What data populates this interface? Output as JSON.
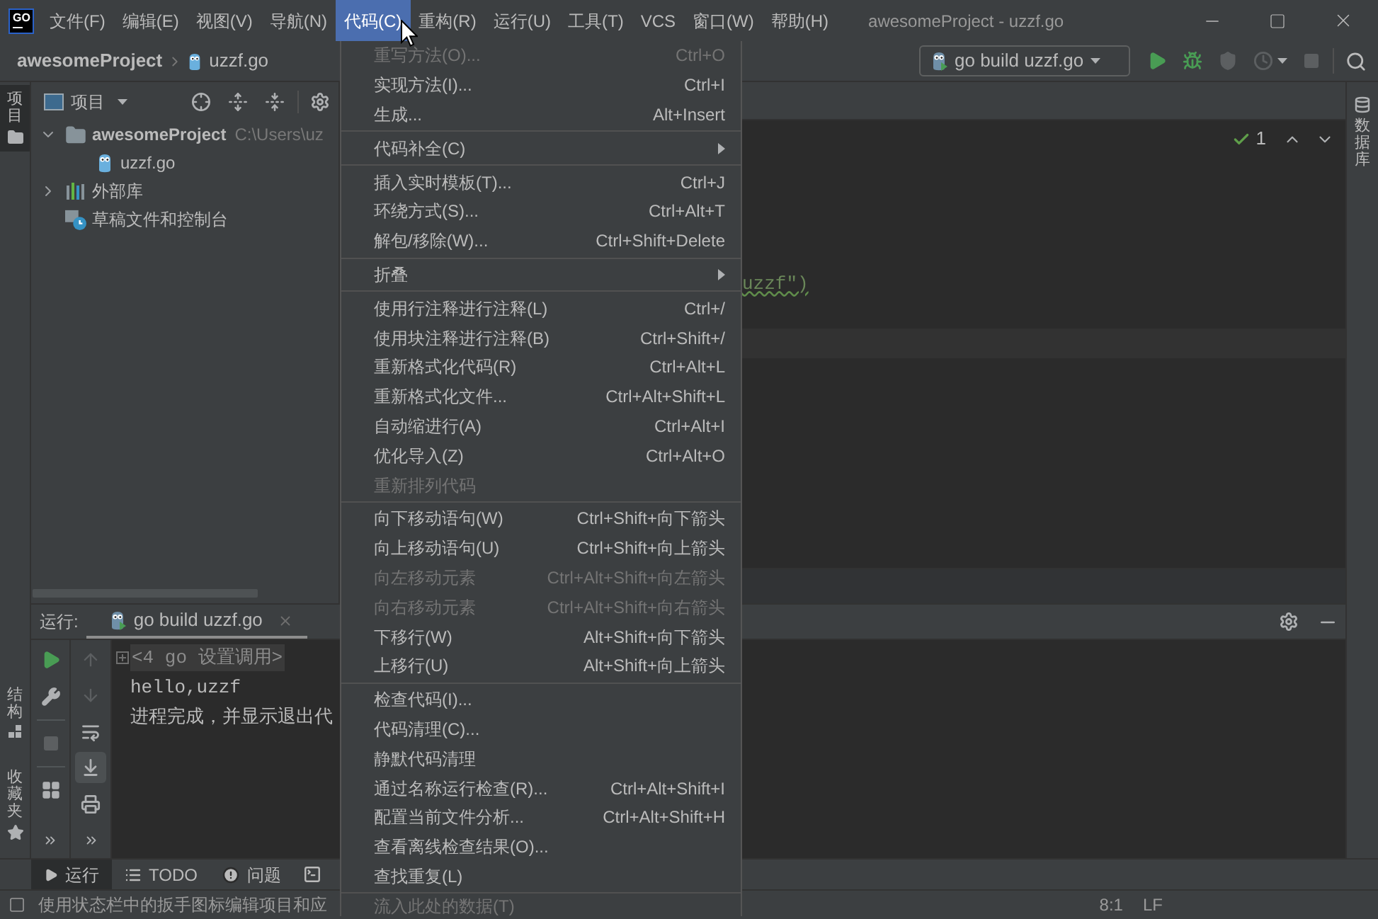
{
  "menubar": {
    "logo": "GO",
    "items": [
      {
        "label": "文件(F)",
        "selected": false
      },
      {
        "label": "编辑(E)",
        "selected": false
      },
      {
        "label": "视图(V)",
        "selected": false
      },
      {
        "label": "导航(N)",
        "selected": false
      },
      {
        "label": "代码(C)",
        "selected": true
      },
      {
        "label": "重构(R)",
        "selected": false
      },
      {
        "label": "运行(U)",
        "selected": false
      },
      {
        "label": "工具(T)",
        "selected": false
      },
      {
        "label": "VCS",
        "selected": false
      },
      {
        "label": "窗口(W)",
        "selected": false
      },
      {
        "label": "帮助(H)",
        "selected": false
      }
    ],
    "title": "awesomeProject - uzzf.go"
  },
  "navbar": {
    "breadcrumbs": [
      "awesomeProject",
      "uzzf.go"
    ],
    "run_config": "go build uzzf.go",
    "actions": [
      {
        "kind": "run",
        "disabled": false
      },
      {
        "kind": "debug",
        "disabled": false
      },
      {
        "kind": "coverage",
        "disabled": true
      },
      {
        "kind": "profile",
        "disabled": true
      },
      {
        "kind": "stop",
        "disabled": true
      }
    ]
  },
  "left_strip": {
    "top": [
      {
        "label": "项目",
        "kind": "project",
        "selected": true
      }
    ],
    "bottom": [
      {
        "label": "结构",
        "kind": "structure",
        "selected": false
      },
      {
        "label": "收藏夹",
        "kind": "favorites",
        "selected": false
      }
    ]
  },
  "project_panel": {
    "view": "项目",
    "tree": [
      {
        "label": "awesomeProject",
        "path": "C:\\Users\\uz",
        "kind": "folder",
        "expanded": true,
        "children": [
          {
            "label": "uzzf.go",
            "kind": "go_file"
          }
        ]
      },
      {
        "label": "外部库",
        "kind": "library",
        "expanded": false
      },
      {
        "label": "草稿文件和控制台",
        "kind": "scratch"
      }
    ]
  },
  "editor": {
    "inspection_count": "1",
    "code_line": {
      "text": "uzzf\")",
      "typo": true
    }
  },
  "right_strip": {
    "tabs": [
      {
        "label": "数据库",
        "kind": "database",
        "selected": false
      }
    ]
  },
  "run_panel": {
    "title": "运行:",
    "tabs": [
      {
        "label": "go build uzzf.go",
        "selected": true
      }
    ],
    "left_tools": [
      {
        "kind": "rerun",
        "disabled": false
      },
      {
        "kind": "settings",
        "disabled": false
      },
      {
        "kind": "stop",
        "disabled": true
      },
      {
        "kind": "layout",
        "disabled": false
      },
      {
        "kind": "more",
        "disabled": false
      }
    ],
    "console_tools": [
      {
        "kind": "up",
        "disabled": true,
        "selected": false
      },
      {
        "kind": "down",
        "disabled": true,
        "selected": false
      },
      {
        "kind": "wrap",
        "disabled": false,
        "selected": false
      },
      {
        "kind": "scroll_end",
        "disabled": false,
        "selected": true
      },
      {
        "kind": "print",
        "disabled": false,
        "selected": false
      },
      {
        "kind": "more",
        "disabled": false,
        "selected": false
      }
    ],
    "console": [
      {
        "text": "<4 go 设置调用>",
        "kind": "folded"
      },
      {
        "text": "hello,uzzf",
        "kind": "output"
      },
      {
        "text": "进程完成，并显示退出代",
        "kind": "output"
      }
    ]
  },
  "bottom_tools": [
    {
      "kind": "run",
      "label": "运行",
      "selected": true
    },
    {
      "kind": "todo",
      "label": "TODO",
      "selected": false
    },
    {
      "kind": "problems",
      "label": "问题",
      "selected": false
    },
    {
      "kind": "terminal",
      "selected": false
    }
  ],
  "status_bar": {
    "message": "使用状态栏中的扳手图标编辑项目和应",
    "position": "8:1",
    "line_separator": "LF"
  },
  "code_menu": {
    "groups": [
      {
        "items": [
          {
            "label": "重写方法(O)...",
            "shortcut": "Ctrl+O",
            "disabled": true,
            "submenu": false
          },
          {
            "label": "实现方法(I)...",
            "shortcut": "Ctrl+I",
            "disabled": false,
            "submenu": false
          },
          {
            "label": "生成...",
            "shortcut": "Alt+Insert",
            "disabled": false,
            "submenu": false
          }
        ]
      },
      {
        "items": [
          {
            "label": "代码补全(C)",
            "disabled": false,
            "submenu": true
          }
        ]
      },
      {
        "items": [
          {
            "label": "插入实时模板(T)...",
            "shortcut": "Ctrl+J",
            "disabled": false,
            "submenu": false
          },
          {
            "label": "环绕方式(S)...",
            "shortcut": "Ctrl+Alt+T",
            "disabled": false,
            "submenu": false
          },
          {
            "label": "解包/移除(W)...",
            "shortcut": "Ctrl+Shift+Delete",
            "disabled": false,
            "submenu": false
          }
        ]
      },
      {
        "items": [
          {
            "label": "折叠",
            "disabled": false,
            "submenu": true
          }
        ]
      },
      {
        "items": [
          {
            "label": "使用行注释进行注释(L)",
            "shortcut": "Ctrl+/",
            "disabled": false,
            "submenu": false
          },
          {
            "label": "使用块注释进行注释(B)",
            "shortcut": "Ctrl+Shift+/",
            "disabled": false,
            "submenu": false
          },
          {
            "label": "重新格式化代码(R)",
            "shortcut": "Ctrl+Alt+L",
            "disabled": false,
            "submenu": false
          },
          {
            "label": "重新格式化文件...",
            "shortcut": "Ctrl+Alt+Shift+L",
            "disabled": false,
            "submenu": false
          },
          {
            "label": "自动缩进行(A)",
            "shortcut": "Ctrl+Alt+I",
            "disabled": false,
            "submenu": false
          },
          {
            "label": "优化导入(Z)",
            "shortcut": "Ctrl+Alt+O",
            "disabled": false,
            "submenu": false
          },
          {
            "label": "重新排列代码",
            "disabled": true,
            "submenu": false
          }
        ]
      },
      {
        "items": [
          {
            "label": "向下移动语句(W)",
            "shortcut": "Ctrl+Shift+向下箭头",
            "disabled": false,
            "submenu": false
          },
          {
            "label": "向上移动语句(U)",
            "shortcut": "Ctrl+Shift+向上箭头",
            "disabled": false,
            "submenu": false
          },
          {
            "label": "向左移动元素",
            "shortcut": "Ctrl+Alt+Shift+向左箭头",
            "disabled": true,
            "submenu": false
          },
          {
            "label": "向右移动元素",
            "shortcut": "Ctrl+Alt+Shift+向右箭头",
            "disabled": true,
            "submenu": false
          },
          {
            "label": "下移行(W)",
            "shortcut": "Alt+Shift+向下箭头",
            "disabled": false,
            "submenu": false
          },
          {
            "label": "上移行(U)",
            "shortcut": "Alt+Shift+向上箭头",
            "disabled": false,
            "submenu": false
          }
        ]
      },
      {
        "items": [
          {
            "label": "检查代码(I)...",
            "disabled": false,
            "submenu": false
          },
          {
            "label": "代码清理(C)...",
            "disabled": false,
            "submenu": false
          },
          {
            "label": "静默代码清理",
            "disabled": false,
            "submenu": false
          },
          {
            "label": "通过名称运行检查(R)...",
            "shortcut": "Ctrl+Alt+Shift+I",
            "disabled": false,
            "submenu": false
          },
          {
            "label": "配置当前文件分析...",
            "shortcut": "Ctrl+Alt+Shift+H",
            "disabled": false,
            "submenu": false
          },
          {
            "label": "查看离线检查结果(O)...",
            "disabled": false,
            "submenu": false
          },
          {
            "label": "查找重复(L)",
            "disabled": false,
            "submenu": false
          }
        ]
      },
      {
        "items": [
          {
            "label": "流入此处的数据(T)",
            "disabled": true,
            "submenu": false
          }
        ]
      }
    ]
  }
}
